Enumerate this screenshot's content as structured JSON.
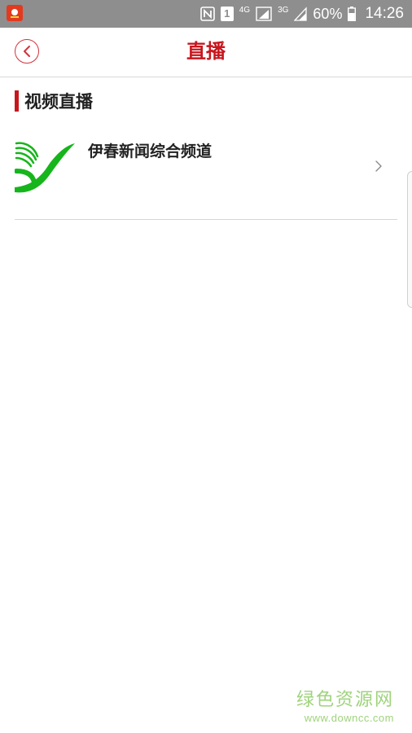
{
  "status_bar": {
    "battery": "60%",
    "time": "14:26",
    "sim_label": "1",
    "network_4g": "4G",
    "network_3g": "3G"
  },
  "header": {
    "title": "直播"
  },
  "section": {
    "title": "视频直播"
  },
  "channels": [
    {
      "name": "伊春新闻综合频道"
    }
  ],
  "watermark": {
    "title": "绿色资源网",
    "url": "www.downcc.com"
  },
  "colors": {
    "accent": "#c8161d",
    "status_bar": "#8e8e8e",
    "logo_green": "#16b51c",
    "watermark": "#9fd37c"
  },
  "icons": {
    "back": "chevron-left-icon",
    "row_arrow": "chevron-right-icon",
    "nfc": "nfc-icon",
    "signal": "signal-icon",
    "battery": "battery-icon"
  }
}
